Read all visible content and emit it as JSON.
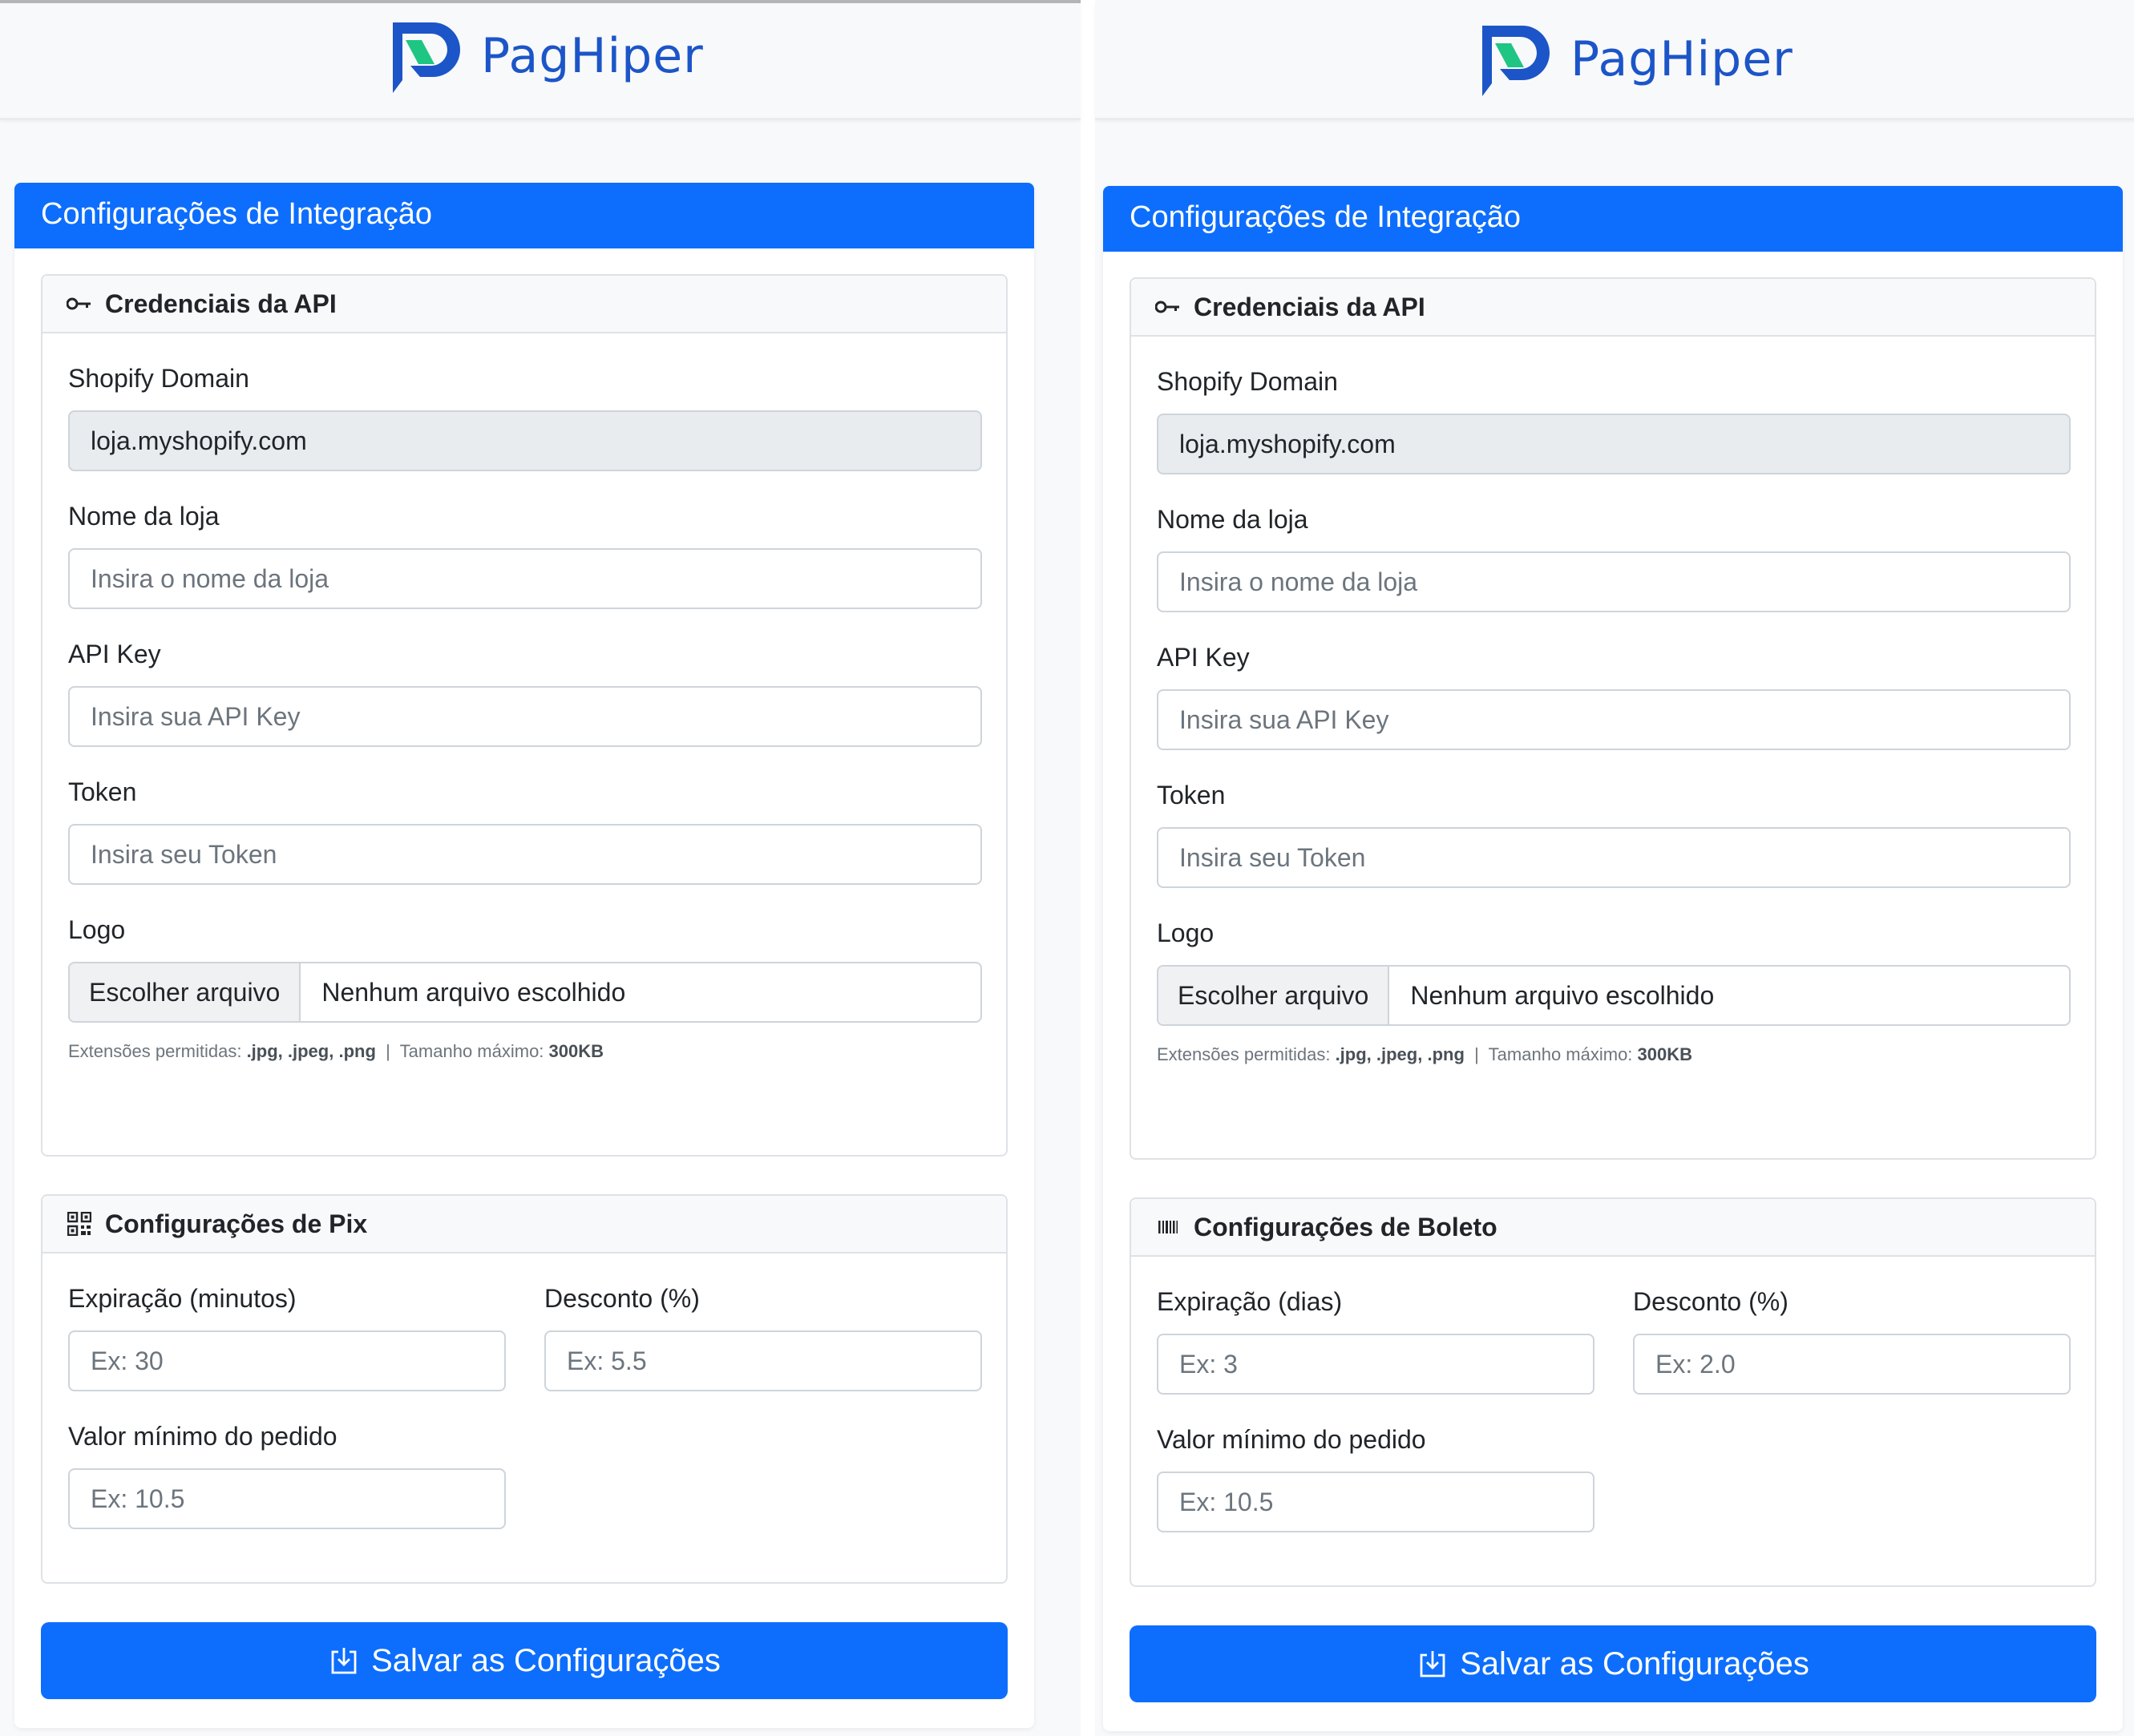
{
  "brand": {
    "name": "PagHiper",
    "logo_color": "#1c55c8",
    "logo_accent": "#1fc683"
  },
  "panels": [
    {
      "card_title": "Configurações de Integração",
      "api_section": {
        "title": "Credenciais da API",
        "icon": "key-icon",
        "shopify_label": "Shopify Domain",
        "shopify_value": "loja.myshopify.com",
        "store_label": "Nome da loja",
        "store_placeholder": "Insira o nome da loja",
        "apikey_label": "API Key",
        "apikey_placeholder": "Insira sua API Key",
        "token_label": "Token",
        "token_placeholder": "Insira seu Token",
        "logo_label": "Logo",
        "file_button": "Escolher arquivo",
        "file_status": "Nenhum arquivo escolhido",
        "help_prefix": "Extensões permitidas:",
        "help_ext": ".jpg, .jpeg, .png",
        "help_sep": "|",
        "help_size_label": "Tamanho máximo:",
        "help_size": "300KB"
      },
      "payment_section": {
        "title": "Configurações de Pix",
        "icon": "qr-code-icon",
        "expiration_label": "Expiração (minutos)",
        "expiration_placeholder": "Ex: 30",
        "discount_label": "Desconto (%)",
        "discount_placeholder": "Ex: 5.5",
        "min_label": "Valor mínimo do pedido",
        "min_placeholder": "Ex: 10.5"
      },
      "save_label": "Salvar as Configurações"
    },
    {
      "card_title": "Configurações de Integração",
      "api_section": {
        "title": "Credenciais da API",
        "icon": "key-icon",
        "shopify_label": "Shopify Domain",
        "shopify_value": "loja.myshopify.com",
        "store_label": "Nome da loja",
        "store_placeholder": "Insira o nome da loja",
        "apikey_label": "API Key",
        "apikey_placeholder": "Insira sua API Key",
        "token_label": "Token",
        "token_placeholder": "Insira seu Token",
        "logo_label": "Logo",
        "file_button": "Escolher arquivo",
        "file_status": "Nenhum arquivo escolhido",
        "help_prefix": "Extensões permitidas:",
        "help_ext": ".jpg, .jpeg, .png",
        "help_sep": "|",
        "help_size_label": "Tamanho máximo:",
        "help_size": "300KB"
      },
      "payment_section": {
        "title": "Configurações de Boleto",
        "icon": "barcode-icon",
        "expiration_label": "Expiração (dias)",
        "expiration_placeholder": "Ex: 3",
        "discount_label": "Desconto (%)",
        "discount_placeholder": "Ex: 2.0",
        "min_label": "Valor mínimo do pedido",
        "min_placeholder": "Ex: 10.5"
      },
      "save_label": "Salvar as Configurações"
    }
  ],
  "colors": {
    "primary": "#0d6efd",
    "border": "#dee2e6",
    "disabled_bg": "#e9ecef"
  }
}
